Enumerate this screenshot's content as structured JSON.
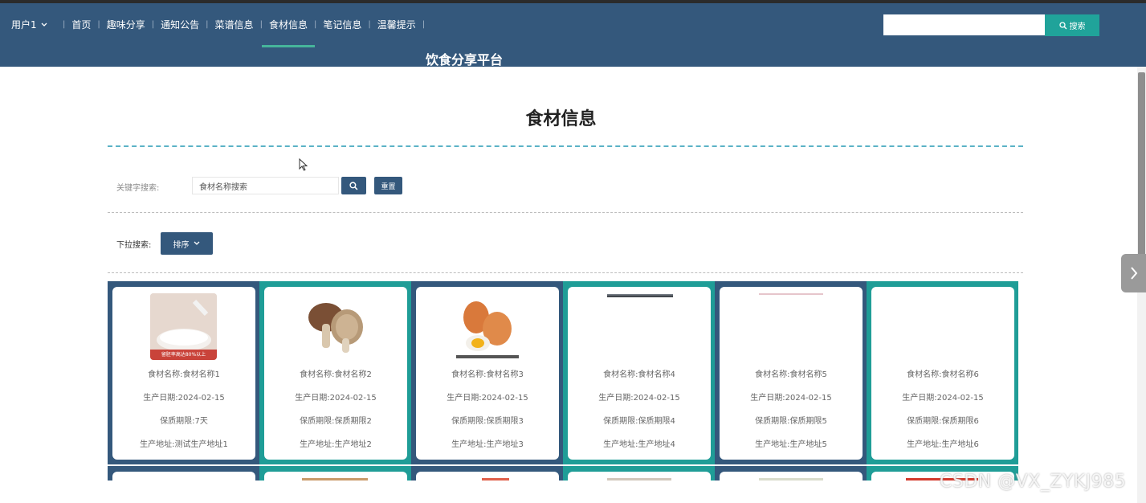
{
  "nav": {
    "user": "用户1",
    "items": [
      "首页",
      "趣味分享",
      "通知公告",
      "菜谱信息",
      "食材信息",
      "笔记信息",
      "温馨提示"
    ],
    "active_index": 4,
    "search_button": "搜索",
    "site_title": "饮食分享平台"
  },
  "page": {
    "heading": "食材信息",
    "keyword_label": "关键字搜索:",
    "keyword_placeholder": "食材名称搜索",
    "reset_label": "重置",
    "dropdown_label": "下拉搜索:",
    "sort_label": "排序"
  },
  "cards": [
    {
      "name": "食材名称:食材名称1",
      "date": "生产日期:2024-02-15",
      "shelf": "保质期限:7天",
      "address": "生产地址:测试生产地址1",
      "badge": "留胚率高达80%以上",
      "image": "rice-bowl"
    },
    {
      "name": "食材名称:食材名称2",
      "date": "生产日期:2024-02-15",
      "shelf": "保质期限:保质期限2",
      "address": "生产地址:生产地址2",
      "image": "mushroom"
    },
    {
      "name": "食材名称:食材名称3",
      "date": "生产日期:2024-02-15",
      "shelf": "保质期限:保质期限3",
      "address": "生产地址:生产地址3",
      "image": "eggs"
    },
    {
      "name": "食材名称:食材名称4",
      "date": "生产日期:2024-02-15",
      "shelf": "保质期限:保质期限4",
      "address": "生产地址:生产地址4",
      "image": "image-strip"
    },
    {
      "name": "食材名称:食材名称5",
      "date": "生产日期:2024-02-15",
      "shelf": "保质期限:保质期限5",
      "address": "生产地址:生产地址5",
      "image": "image-strip"
    },
    {
      "name": "食材名称:食材名称6",
      "date": "生产日期:2024-02-15",
      "shelf": "保质期限:保质期限6",
      "address": "生产地址:生产地址6",
      "image": "none"
    }
  ],
  "watermark": "CSDN @VX_ZYKJ985",
  "colors": {
    "navbar": "#34587c",
    "teal": "#1f9d97",
    "accent_line": "#46b59b",
    "search_btn": "#20a39a"
  }
}
